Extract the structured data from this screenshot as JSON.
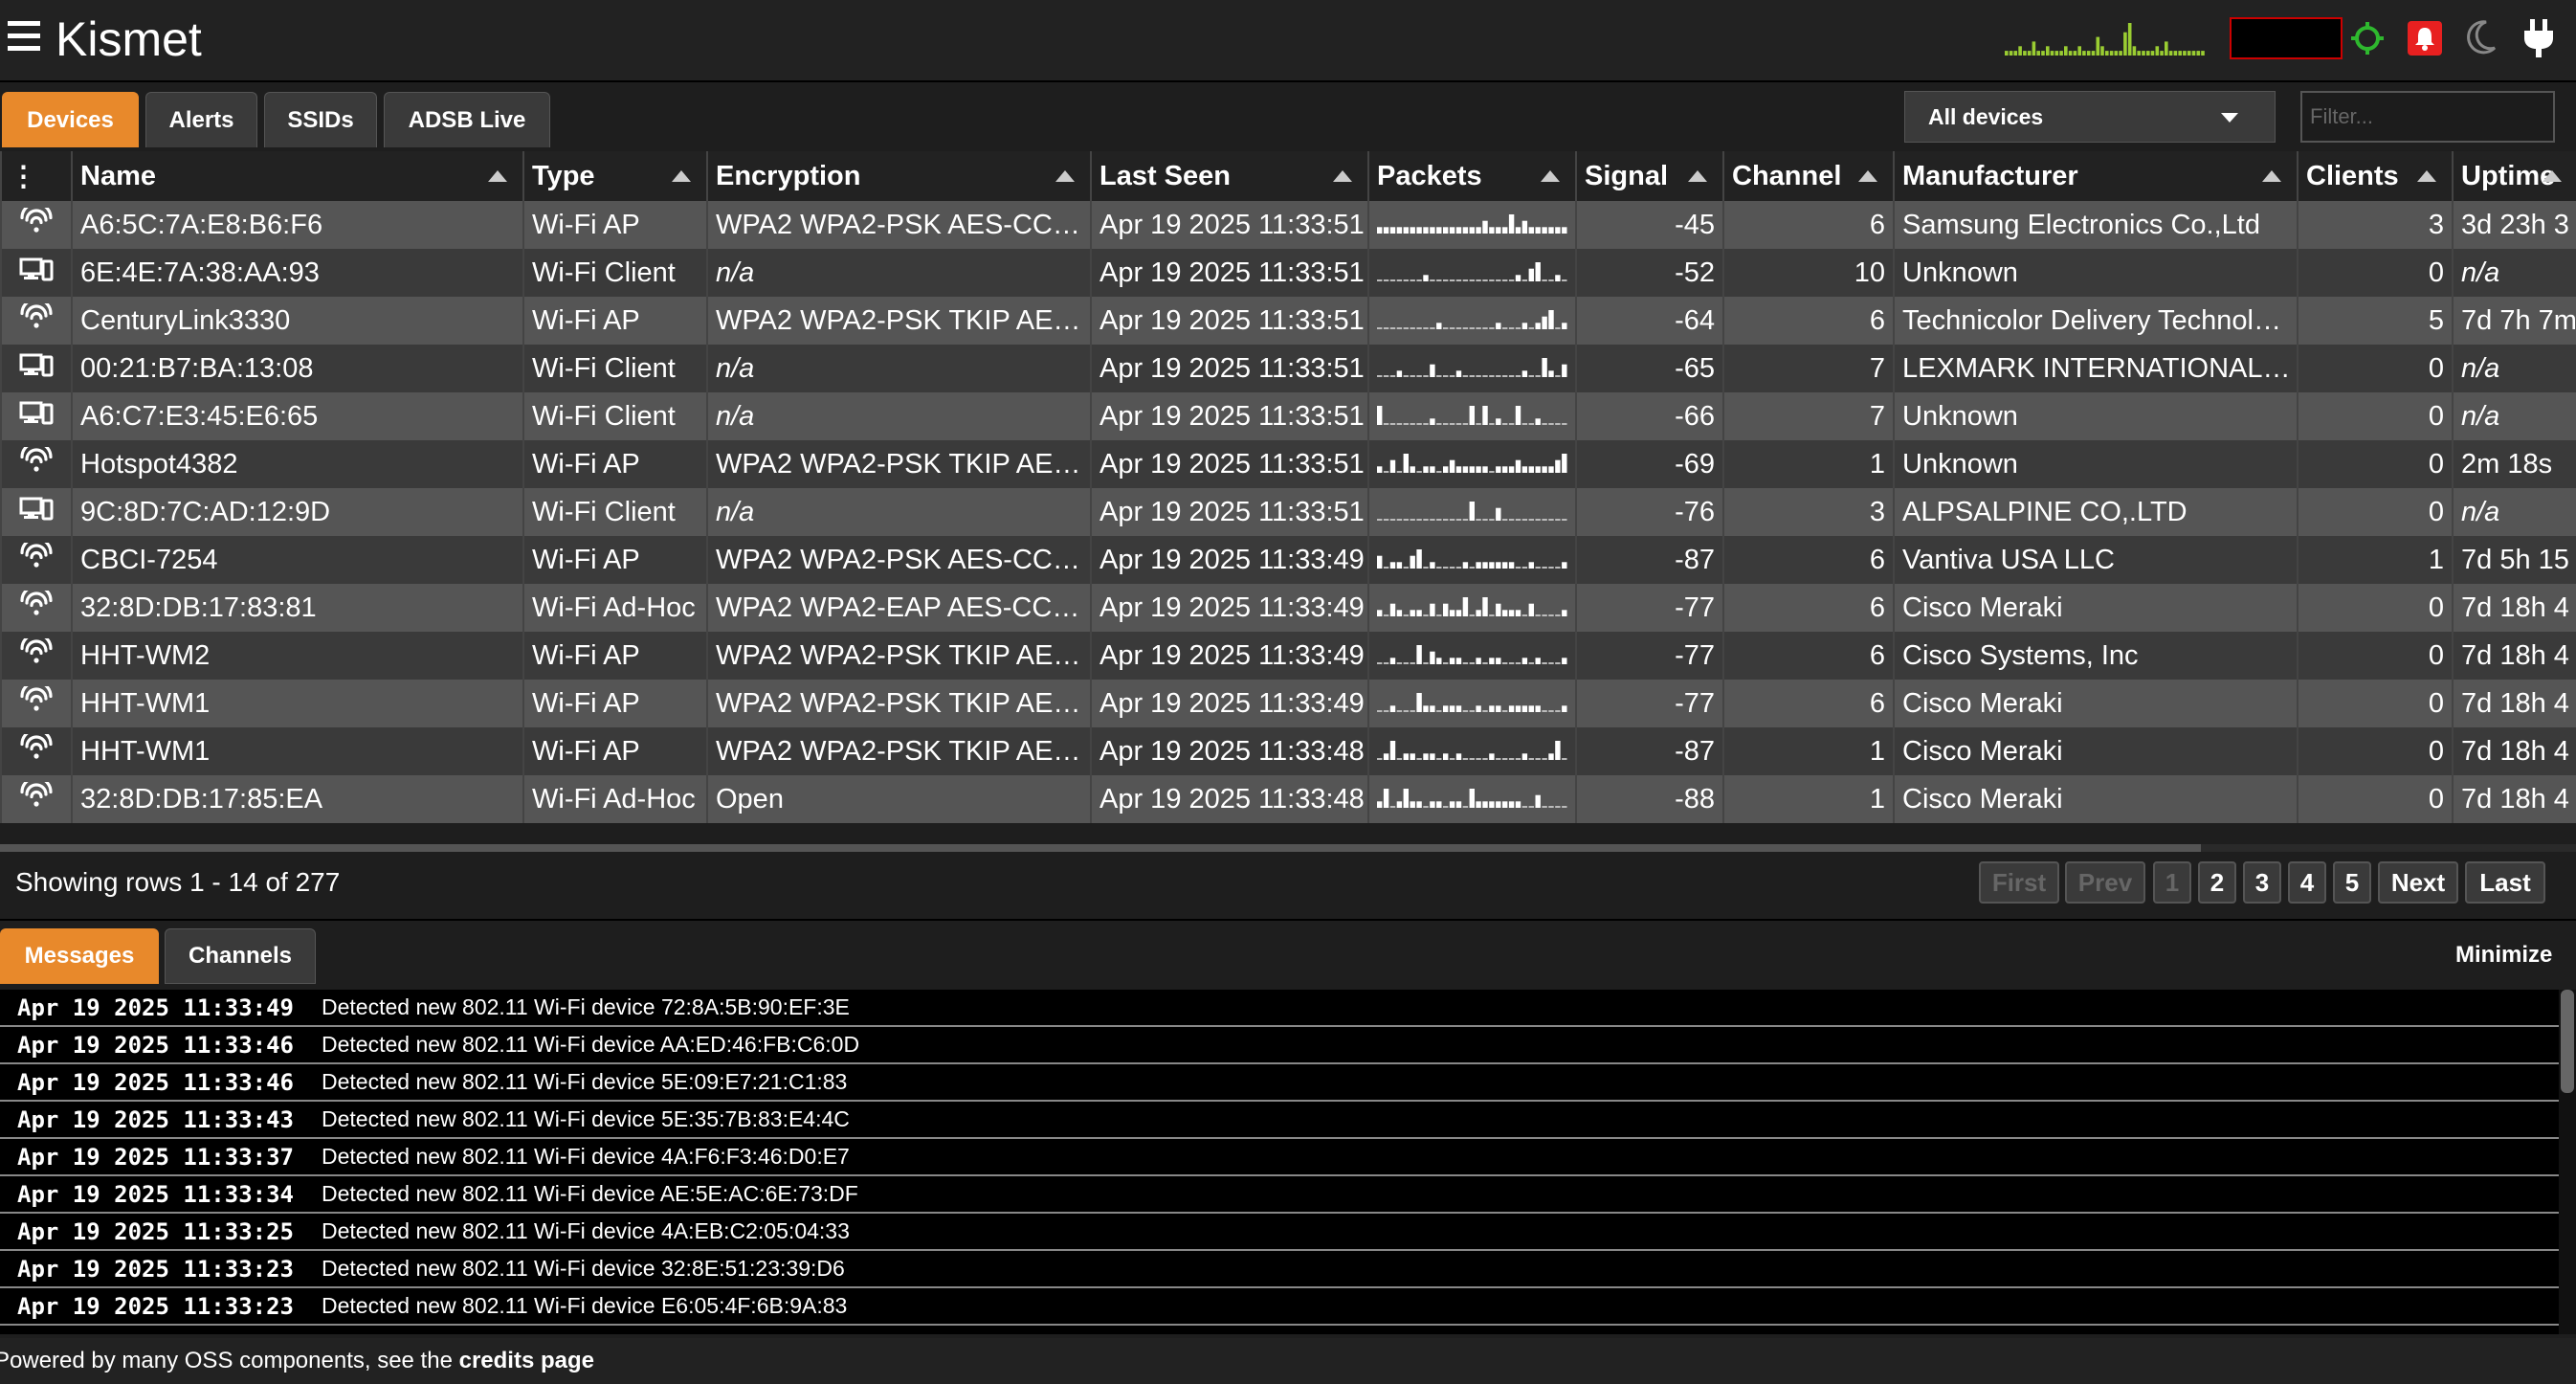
{
  "app": {
    "title": "Kismet"
  },
  "top_icons": [
    "gps-icon",
    "alert-bell-icon",
    "moon-icon",
    "power-plug-icon"
  ],
  "activity_sparkline": [
    1,
    1,
    1,
    2,
    1,
    1,
    3,
    1,
    1,
    2,
    1,
    1,
    1,
    2,
    1,
    1,
    2,
    1,
    1,
    1,
    4,
    2,
    1,
    1,
    1,
    1,
    5,
    7,
    2,
    1,
    1,
    1,
    1,
    2,
    1,
    3,
    1,
    1,
    1,
    1,
    1,
    1,
    1,
    1
  ],
  "colors": {
    "accent": "#e8892b",
    "gps_ok": "#2eb82e",
    "alert": "#e82020",
    "spark": "#9acd32"
  },
  "tabs": [
    {
      "label": "Devices",
      "active": true
    },
    {
      "label": "Alerts",
      "active": false
    },
    {
      "label": "SSIDs",
      "active": false
    },
    {
      "label": "ADSB Live",
      "active": false
    }
  ],
  "device_view": {
    "selected": "All devices"
  },
  "filter": {
    "placeholder": "Filter..."
  },
  "table": {
    "columns": [
      {
        "key": "menu",
        "label": "⋮"
      },
      {
        "key": "name",
        "label": "Name"
      },
      {
        "key": "type",
        "label": "Type"
      },
      {
        "key": "encryption",
        "label": "Encryption"
      },
      {
        "key": "last_seen",
        "label": "Last Seen"
      },
      {
        "key": "packets",
        "label": "Packets"
      },
      {
        "key": "signal",
        "label": "Signal"
      },
      {
        "key": "channel",
        "label": "Channel"
      },
      {
        "key": "manufacturer",
        "label": "Manufacturer"
      },
      {
        "key": "clients",
        "label": "Clients"
      },
      {
        "key": "uptime",
        "label": "Uptime"
      }
    ],
    "rows": [
      {
        "icon": "wifi-icon",
        "name": "A6:5C:7A:E8:B6:F6",
        "type": "Wi-Fi AP",
        "encryption": "WPA2 WPA2-PSK AES-CCMP",
        "enc_na": false,
        "last_seen": "Apr 19 2025 11:33:51",
        "packets": [
          1,
          1,
          1,
          1,
          1,
          1,
          1,
          1,
          1,
          1,
          1,
          1,
          1,
          1,
          1,
          1,
          2,
          1,
          1,
          1,
          3,
          1,
          2,
          1,
          1,
          1,
          1,
          1,
          1
        ],
        "signal": "-45",
        "channel": "6",
        "manufacturer": "Samsung Electronics Co.,Ltd",
        "clients": "3",
        "uptime": "3d 23h 3",
        "uptime_na": false
      },
      {
        "icon": "device-icon",
        "name": "6E:4E:7A:38:AA:93",
        "type": "Wi-Fi Client",
        "encryption": "n/a",
        "enc_na": true,
        "last_seen": "Apr 19 2025 11:33:51",
        "packets": [
          0,
          0,
          0,
          0,
          0,
          0,
          0,
          1,
          0,
          0,
          0,
          0,
          0,
          0,
          0,
          0,
          0,
          0,
          0,
          0,
          0,
          1,
          0,
          2,
          3,
          0,
          0,
          1,
          0
        ],
        "signal": "-52",
        "channel": "10",
        "manufacturer": "Unknown",
        "clients": "0",
        "uptime": "n/a",
        "uptime_na": true
      },
      {
        "icon": "wifi-icon",
        "name": "CenturyLink3330",
        "type": "Wi-Fi AP",
        "encryption": "WPA2 WPA2-PSK TKIP AE…",
        "enc_na": false,
        "last_seen": "Apr 19 2025 11:33:51",
        "packets": [
          0,
          0,
          0,
          0,
          0,
          0,
          0,
          0,
          0,
          1,
          0,
          0,
          0,
          0,
          0,
          0,
          0,
          0,
          1,
          0,
          0,
          0,
          1,
          0,
          1,
          2,
          3,
          0,
          1
        ],
        "signal": "-64",
        "channel": "6",
        "manufacturer": "Technicolor Delivery Technolo…",
        "clients": "5",
        "uptime": "7d 7h 7m",
        "uptime_na": false
      },
      {
        "icon": "device-icon",
        "name": "00:21:B7:BA:13:08",
        "type": "Wi-Fi Client",
        "encryption": "n/a",
        "enc_na": true,
        "last_seen": "Apr 19 2025 11:33:51",
        "packets": [
          0,
          0,
          0,
          1,
          0,
          0,
          0,
          0,
          2,
          0,
          0,
          0,
          1,
          0,
          0,
          0,
          0,
          0,
          0,
          0,
          0,
          0,
          1,
          0,
          0,
          3,
          1,
          0,
          2
        ],
        "signal": "-65",
        "channel": "7",
        "manufacturer": "LEXMARK INTERNATIONAL, I…",
        "clients": "0",
        "uptime": "n/a",
        "uptime_na": true
      },
      {
        "icon": "device-icon",
        "name": "A6:C7:E3:45:E6:65",
        "type": "Wi-Fi Client",
        "encryption": "n/a",
        "enc_na": true,
        "last_seen": "Apr 19 2025 11:33:51",
        "packets": [
          3,
          0,
          0,
          0,
          0,
          0,
          0,
          0,
          1,
          0,
          0,
          0,
          0,
          0,
          3,
          0,
          3,
          0,
          1,
          0,
          0,
          3,
          0,
          0,
          1,
          0,
          0,
          0,
          0
        ],
        "signal": "-66",
        "channel": "7",
        "manufacturer": "Unknown",
        "clients": "0",
        "uptime": "n/a",
        "uptime_na": true
      },
      {
        "icon": "wifi-icon",
        "name": "Hotspot4382",
        "type": "Wi-Fi AP",
        "encryption": "WPA2 WPA2-PSK TKIP AE…",
        "enc_na": false,
        "last_seen": "Apr 19 2025 11:33:51",
        "packets": [
          1,
          0,
          2,
          0,
          3,
          1,
          0,
          1,
          1,
          0,
          1,
          2,
          1,
          1,
          1,
          1,
          1,
          0,
          1,
          1,
          1,
          2,
          1,
          1,
          1,
          1,
          1,
          2,
          3
        ],
        "signal": "-69",
        "channel": "1",
        "manufacturer": "Unknown",
        "clients": "0",
        "uptime": "2m 18s",
        "uptime_na": false
      },
      {
        "icon": "device-icon",
        "name": "9C:8D:7C:AD:12:9D",
        "type": "Wi-Fi Client",
        "encryption": "n/a",
        "enc_na": true,
        "last_seen": "Apr 19 2025 11:33:51",
        "packets": [
          0,
          0,
          0,
          0,
          0,
          0,
          0,
          0,
          0,
          0,
          0,
          0,
          0,
          0,
          3,
          0,
          0,
          0,
          2,
          0,
          0,
          0,
          0,
          0,
          0,
          0,
          0,
          0,
          0
        ],
        "signal": "-76",
        "channel": "3",
        "manufacturer": "ALPSALPINE CO,.LTD",
        "clients": "0",
        "uptime": "n/a",
        "uptime_na": true
      },
      {
        "icon": "wifi-icon",
        "name": "CBCI-7254",
        "type": "Wi-Fi AP",
        "encryption": "WPA2 WPA2-PSK AES-CCMP",
        "enc_na": false,
        "last_seen": "Apr 19 2025 11:33:49",
        "packets": [
          2,
          0,
          1,
          1,
          0,
          2,
          3,
          0,
          1,
          0,
          0,
          0,
          0,
          1,
          0,
          1,
          1,
          1,
          1,
          1,
          1,
          0,
          0,
          1,
          0,
          0,
          0,
          0,
          1
        ],
        "signal": "-87",
        "channel": "6",
        "manufacturer": "Vantiva USA LLC",
        "clients": "1",
        "uptime": "7d 5h 15",
        "uptime_na": false
      },
      {
        "icon": "wifi-icon",
        "name": "32:8D:DB:17:83:81",
        "type": "Wi-Fi Ad-Hoc",
        "encryption": "WPA2 WPA2-EAP AES-CCMP",
        "enc_na": false,
        "last_seen": "Apr 19 2025 11:33:49",
        "packets": [
          1,
          0,
          2,
          1,
          0,
          1,
          1,
          0,
          2,
          0,
          2,
          1,
          1,
          3,
          0,
          1,
          3,
          0,
          2,
          1,
          1,
          1,
          0,
          2,
          0,
          0,
          0,
          0,
          1
        ],
        "signal": "-77",
        "channel": "6",
        "manufacturer": "Cisco Meraki",
        "clients": "0",
        "uptime": "7d 18h 4",
        "uptime_na": false
      },
      {
        "icon": "wifi-icon",
        "name": "HHT-WM2",
        "type": "Wi-Fi AP",
        "encryption": "WPA2 WPA2-PSK TKIP AE…",
        "enc_na": false,
        "last_seen": "Apr 19 2025 11:33:49",
        "packets": [
          0,
          0,
          1,
          0,
          0,
          0,
          3,
          0,
          2,
          1,
          0,
          1,
          1,
          0,
          0,
          1,
          0,
          1,
          1,
          0,
          0,
          0,
          1,
          0,
          1,
          0,
          0,
          0,
          1
        ],
        "signal": "-77",
        "channel": "6",
        "manufacturer": "Cisco Systems, Inc",
        "clients": "0",
        "uptime": "7d 18h 4",
        "uptime_na": false
      },
      {
        "icon": "wifi-icon",
        "name": "HHT-WM1",
        "type": "Wi-Fi AP",
        "encryption": "WPA2 WPA2-PSK TKIP AE…",
        "enc_na": false,
        "last_seen": "Apr 19 2025 11:33:49",
        "packets": [
          0,
          0,
          1,
          0,
          0,
          0,
          3,
          1,
          1,
          0,
          1,
          1,
          1,
          0,
          0,
          1,
          0,
          1,
          1,
          0,
          1,
          1,
          1,
          1,
          1,
          0,
          0,
          0,
          1
        ],
        "signal": "-77",
        "channel": "6",
        "manufacturer": "Cisco Meraki",
        "clients": "0",
        "uptime": "7d 18h 4",
        "uptime_na": false
      },
      {
        "icon": "wifi-icon",
        "name": "HHT-WM1",
        "type": "Wi-Fi AP",
        "encryption": "WPA2 WPA2-PSK TKIP AE…",
        "enc_na": false,
        "last_seen": "Apr 19 2025 11:33:48",
        "packets": [
          0,
          1,
          3,
          0,
          1,
          1,
          0,
          1,
          1,
          0,
          1,
          0,
          1,
          0,
          0,
          0,
          0,
          1,
          0,
          0,
          0,
          0,
          1,
          0,
          0,
          0,
          1,
          3,
          0
        ],
        "signal": "-87",
        "channel": "1",
        "manufacturer": "Cisco Meraki",
        "clients": "0",
        "uptime": "7d 18h 4",
        "uptime_na": false
      },
      {
        "icon": "wifi-icon",
        "name": "32:8D:DB:17:85:EA",
        "type": "Wi-Fi Ad-Hoc",
        "encryption": "Open",
        "enc_na": false,
        "last_seen": "Apr 19 2025 11:33:48",
        "packets": [
          1,
          3,
          0,
          1,
          3,
          1,
          1,
          0,
          1,
          1,
          0,
          1,
          1,
          0,
          3,
          1,
          1,
          1,
          1,
          1,
          1,
          1,
          0,
          0,
          2,
          0,
          0,
          0,
          0
        ],
        "signal": "-88",
        "channel": "1",
        "manufacturer": "Cisco Meraki",
        "clients": "0",
        "uptime": "7d 18h 4",
        "uptime_na": false
      }
    ]
  },
  "pagination": {
    "info": "Showing rows 1 - 14 of 277",
    "buttons": [
      "First",
      "Prev",
      "1",
      "2",
      "3",
      "4",
      "5",
      "Next",
      "Last"
    ]
  },
  "messages_panel": {
    "tabs": [
      "Messages",
      "Channels"
    ],
    "minimize": "Minimize",
    "messages": [
      {
        "time": "Apr 19 2025 11:33:49",
        "text": "Detected new 802.11 Wi-Fi device 72:8A:5B:90:EF:3E"
      },
      {
        "time": "Apr 19 2025 11:33:46",
        "text": "Detected new 802.11 Wi-Fi device AA:ED:46:FB:C6:0D"
      },
      {
        "time": "Apr 19 2025 11:33:46",
        "text": "Detected new 802.11 Wi-Fi device 5E:09:E7:21:C1:83"
      },
      {
        "time": "Apr 19 2025 11:33:43",
        "text": "Detected new 802.11 Wi-Fi device 5E:35:7B:83:E4:4C"
      },
      {
        "time": "Apr 19 2025 11:33:37",
        "text": "Detected new 802.11 Wi-Fi device 4A:F6:F3:46:D0:E7"
      },
      {
        "time": "Apr 19 2025 11:33:34",
        "text": "Detected new 802.11 Wi-Fi device AE:5E:AC:6E:73:DF"
      },
      {
        "time": "Apr 19 2025 11:33:25",
        "text": "Detected new 802.11 Wi-Fi device 4A:EB:C2:05:04:33"
      },
      {
        "time": "Apr 19 2025 11:33:23",
        "text": "Detected new 802.11 Wi-Fi device 32:8E:51:23:39:D6"
      },
      {
        "time": "Apr 19 2025 11:33:23",
        "text": "Detected new 802.11 Wi-Fi device E6:05:4F:6B:9A:83"
      }
    ]
  },
  "footer": {
    "text": "Powered by many OSS components, see the ",
    "link": "credits page"
  }
}
